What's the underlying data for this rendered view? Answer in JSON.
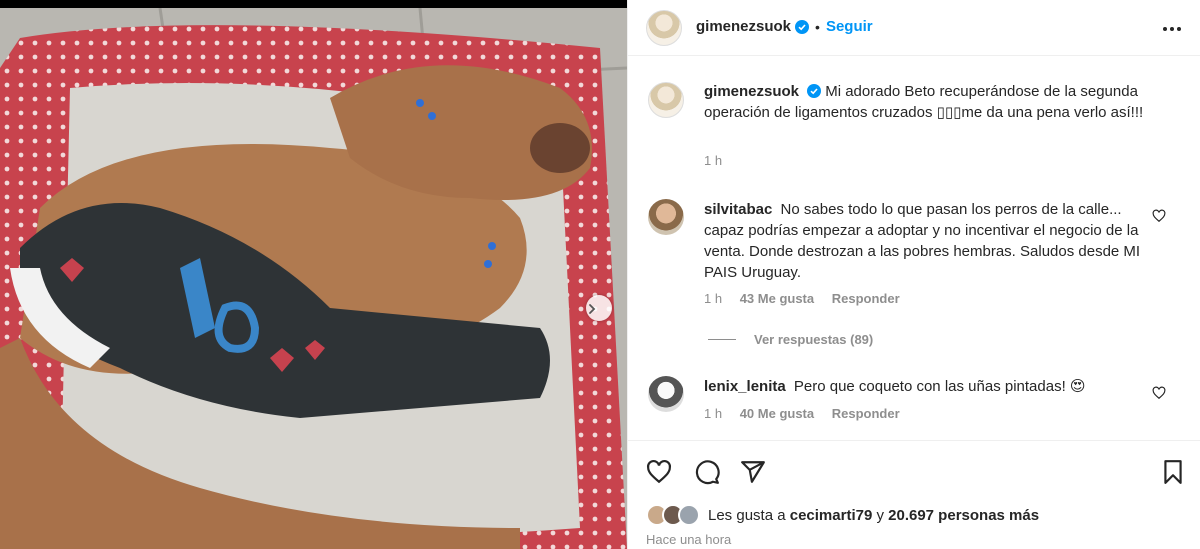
{
  "post": {
    "author": "gimenezsuok",
    "follow_label": "Seguir",
    "separator": "•"
  },
  "caption": {
    "author": "gimenezsuok",
    "text": "Mi adorado Beto recuperándose de la segunda operación de ligamentos cruzados ▯▯▯me da una pena verlo así!!!",
    "time": "1 h"
  },
  "comments": [
    {
      "user": "silvitabac",
      "text": "No sabes todo lo que pasan los perros de la calle... capaz podrías empezar a adoptar y no incentivar el negocio de la venta. Donde destrozan a las pobres hembras. Saludos desde MI PAIS Uruguay.",
      "time": "1 h",
      "likes": "43 Me gusta",
      "reply_label": "Responder"
    },
    {
      "user": "lenix_lenita",
      "text": "Pero que coqueto con las uñas pintadas! 😍",
      "time": "1 h",
      "likes": "40 Me gusta",
      "reply_label": "Responder"
    }
  ],
  "view_replies": "Ver respuestas (89)",
  "likes": {
    "prefix": "Les gusta a",
    "user": "cecimarti79",
    "middle": "y",
    "count": "20.697 personas más"
  },
  "timestamp": "Hace una hora",
  "icons": {
    "verified": "verified-badge-icon",
    "more": "more-options-icon",
    "like": "heart-icon",
    "comment": "comment-bubble-icon",
    "share": "paper-plane-icon",
    "save": "bookmark-icon",
    "next": "chevron-right-icon"
  },
  "colors": {
    "accent": "#0095f6",
    "text": "#262626",
    "muted": "#8e8e8e",
    "border": "#efefef"
  }
}
